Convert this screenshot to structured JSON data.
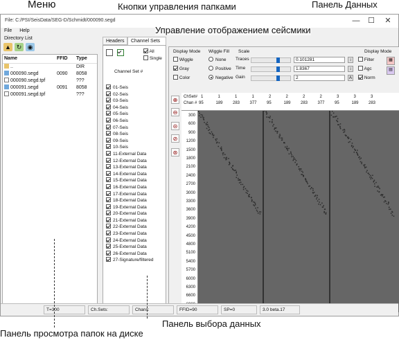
{
  "annotations": {
    "menu": "Меню",
    "folder_buttons": "Кнопки управления папками",
    "data_panel": "Панель Данных",
    "seismic_display": "Управление отображением сейсмики",
    "file_browser": "Панель просмотра папок на диске",
    "data_selection": "Панель выбора данных"
  },
  "window": {
    "title": "File: C:/PSI/SeisData/SEG-D/Schmidt/000090.segd",
    "controls": [
      "—",
      "☐",
      "✕"
    ]
  },
  "menu": {
    "file": "File",
    "help": "Help"
  },
  "directory": {
    "label": "Directory List",
    "columns": [
      "Name",
      "FFID",
      "Type"
    ],
    "rows": [
      {
        "name": "..",
        "ffid": "",
        "type": "DIR",
        "icon": "folder-icon"
      },
      {
        "name": "000090.segd",
        "ffid": "0090",
        "type": "8058",
        "icon": "segd-file-icon"
      },
      {
        "name": "000090.segd.tpf",
        "ffid": "",
        "type": "???",
        "icon": "tpf-file-icon"
      },
      {
        "name": "000091.segd",
        "ffid": "0091",
        "type": "8058",
        "icon": "segd-file-icon"
      },
      {
        "name": "000091.segd.tpf",
        "ffid": "",
        "type": "???",
        "icon": "tpf-file-icon"
      }
    ]
  },
  "selection": {
    "tabs": [
      "Headers",
      "Channel Sets"
    ],
    "all_label": "All",
    "single_label": "Single",
    "header": "Channel Set #",
    "items": [
      "01-Seis",
      "02-Seis",
      "03-Seis",
      "04-Seis",
      "05-Seis",
      "06-Seis",
      "07-Seis",
      "08-Seis",
      "09-Seis",
      "10-Seis",
      "11-External Data",
      "12-External Data",
      "13-External Data",
      "14-External Data",
      "15-External Data",
      "16-External Data",
      "17-External Data",
      "18-External Data",
      "19-External Data",
      "20-External Data",
      "21-External Data",
      "22-External Data",
      "23-External Data",
      "24-External Data",
      "25-External Data",
      "26-External Data",
      "27-Signature/filtered"
    ]
  },
  "display": {
    "display_mode_label": "Display Mode",
    "wiggle_fill_label": "Wiggle Fill",
    "scale_label": "Scale",
    "display_mode_right_label": "Display Mode",
    "wiggle": "Wiggle",
    "gray": "Gray",
    "color": "Color",
    "fill_none": "None",
    "fill_positive": "Positive",
    "fill_negative": "Negative",
    "traces_label": "Traces",
    "time_label": "Time",
    "gain_label": "Gain",
    "traces_value": "0.101281",
    "time_value": "1.8367",
    "gain_value": "2",
    "filter": "Filter",
    "agc": "Agc",
    "norm": "Norm",
    "step_a": "A"
  },
  "header_rows": {
    "chset_label": "ChSet#",
    "chan_label": "Chan #"
  },
  "chset_labels": [
    "1",
    "1",
    "1",
    "1",
    "2",
    "2",
    "2",
    "2",
    "3",
    "3",
    "3"
  ],
  "chan_labels": [
    "95",
    "189",
    "283",
    "377",
    "95",
    "189",
    "283",
    "377",
    "95",
    "189",
    "283"
  ],
  "time_ticks": [
    "300",
    "600",
    "900",
    "1200",
    "1500",
    "1800",
    "2100",
    "2400",
    "2700",
    "3000",
    "3300",
    "3600",
    "3900",
    "4200",
    "4500",
    "4800",
    "5100",
    "5400",
    "5700",
    "6000",
    "6300",
    "6600",
    "6900"
  ],
  "status": {
    "t": "T=300",
    "chsets": "Ch.Sets:",
    "chans": "Chans:",
    "ffid": "FFID=90",
    "sp": "SP=0",
    "version": "3.0 beta.17"
  },
  "colors": {
    "accent": "#1565c0",
    "plot_bg": "#666666",
    "event": "#2b2b2b",
    "divider": "#111111"
  }
}
